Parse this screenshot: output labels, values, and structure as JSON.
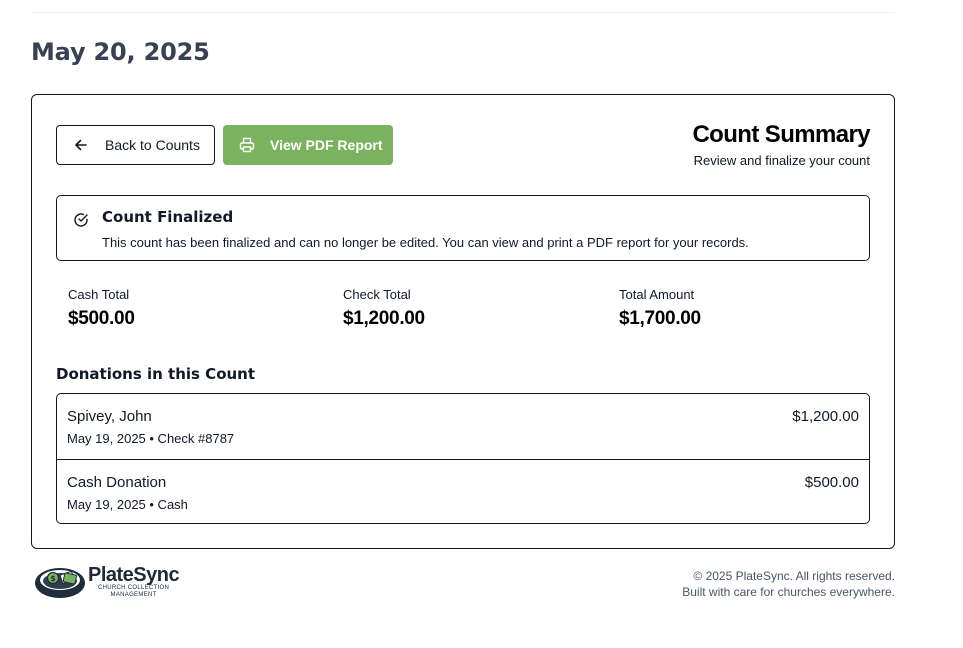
{
  "page": {
    "date_heading": "May 20, 2025"
  },
  "toolbar": {
    "back_label": "Back to Counts",
    "pdf_label": "View PDF Report",
    "pdf_color": "#7bb25f"
  },
  "summary": {
    "title": "Count Summary",
    "subtitle": "Review and finalize your count"
  },
  "notice": {
    "title": "Count Finalized",
    "text": "This count has been finalized and can no longer be edited. You can view and print a PDF report for your records."
  },
  "totals": {
    "cash_label": "Cash Total",
    "cash_value": "$500.00",
    "check_label": "Check Total",
    "check_value": "$1,200.00",
    "amount_label": "Total Amount",
    "amount_value": "$1,700.00"
  },
  "donations": {
    "title": "Donations in this Count",
    "rows": [
      {
        "name": "Spivey, John",
        "meta": "May 19, 2025 • Check #8787",
        "amount": "$1,200.00"
      },
      {
        "name": "Cash Donation",
        "meta": "May 19, 2025 • Cash",
        "amount": "$500.00"
      }
    ]
  },
  "footer": {
    "brand": "PlateSync",
    "tagline_1": "CHURCH COLLECTION",
    "tagline_2": "MANAGEMENT",
    "copyright": "© 2025 PlateSync. All rights reserved.",
    "built": "Built with care for churches everywhere."
  },
  "icons": {
    "back": "arrow-left-icon",
    "pdf": "printer-icon",
    "notice": "check-circle-icon",
    "logo": "offering-plate-icon"
  }
}
